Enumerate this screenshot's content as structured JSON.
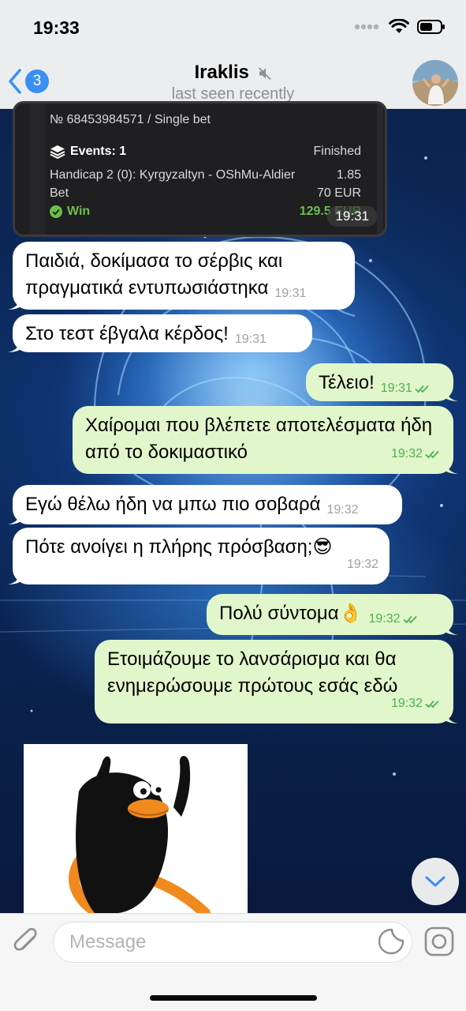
{
  "status_bar": {
    "time": "19:33"
  },
  "header": {
    "back_count": "3",
    "contact_name": "Iraklis",
    "contact_status": "last seen recently"
  },
  "bet_card": {
    "bet_id": "№ 68453984571 / Single bet",
    "events_label": "Events: 1",
    "status": "Finished",
    "match": "Handicap 2 (0): Kyrgyzaltyn - OShMu-Aldier",
    "odds": "1.85",
    "bet_label": "Bet",
    "stake": "70 EUR",
    "result": "Win",
    "payout": "129.5 EUR",
    "time": "19:31"
  },
  "messages": [
    {
      "dir": "in",
      "text": "Παιδιά, δοκίμασα το σέρβις και πραγματικά εντυπωσιάστηκα",
      "time": "19:31"
    },
    {
      "dir": "in",
      "text": "Στο τεστ έβγαλα κέρδος!",
      "time": "19:31"
    },
    {
      "dir": "out",
      "text": "Τέλειο!",
      "time": "19:31"
    },
    {
      "dir": "out",
      "text": "Χαίρομαι που βλέπετε αποτελέσματα ήδη από το δοκιμαστικό",
      "time": "19:32"
    },
    {
      "dir": "in",
      "text": "Εγώ θέλω ήδη να μπω πιο σοβαρά",
      "time": "19:32"
    },
    {
      "dir": "in",
      "text": "Πότε ανοίγει η πλήρης πρόσβαση;",
      "emoji": "😎",
      "time": "19:32"
    },
    {
      "dir": "out",
      "text": "Πολύ σύντομα",
      "emoji": "👌",
      "time": "19:32"
    },
    {
      "dir": "out",
      "text": "Ετοιμάζουμε το λανσάρισμα και θα ενημερώσουμε πρώτους εσάς εδώ",
      "time": "19:32"
    }
  ],
  "input": {
    "placeholder": "Message"
  },
  "colors": {
    "accent": "#3a8ff2",
    "outgoing_bubble": "#e1f7cb",
    "incoming_bubble": "#ffffff",
    "outgoing_time": "#4fae4e",
    "win_green": "#6cc04a"
  },
  "icons": [
    "signal-icon",
    "wifi-icon",
    "battery-icon",
    "back-chevron-icon",
    "mute-icon",
    "layers-icon",
    "check-circle-icon",
    "double-check-icon",
    "chevron-down-icon",
    "paperclip-icon",
    "sticker-icon",
    "camera-icon"
  ]
}
